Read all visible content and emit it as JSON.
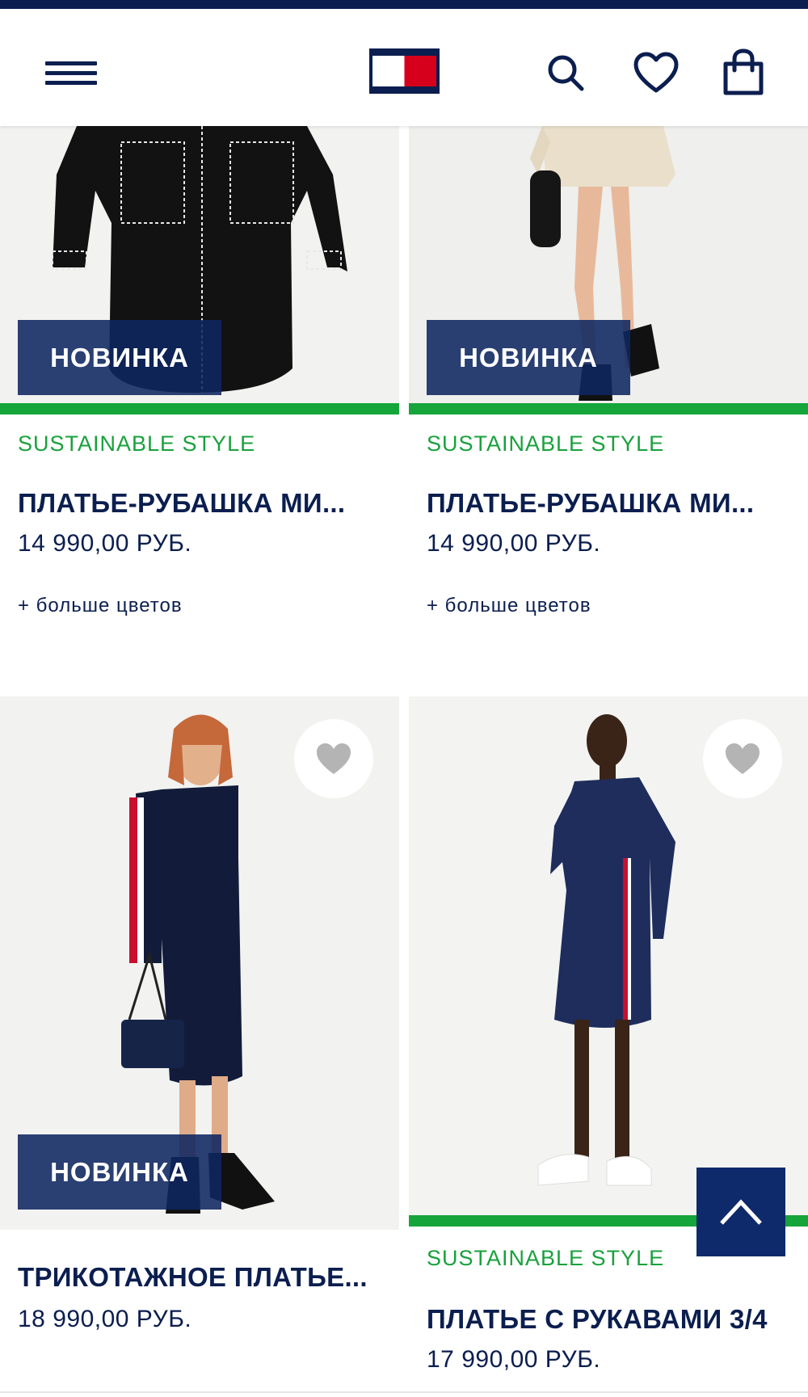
{
  "header": {
    "menu_icon": "hamburger-menu-icon",
    "logo": "tommy-hilfiger-flag-logo",
    "search_icon": "search-icon",
    "wishlist_icon": "heart-icon",
    "cart_icon": "shopping-bag-icon",
    "brand_colors": {
      "navy": "#0b1e4f",
      "red": "#d6001c",
      "white": "#ffffff"
    }
  },
  "products": [
    {
      "badge": "НОВИНКА",
      "label": "SUSTAINABLE STYLE",
      "title": "ПЛАТЬЕ-РУБАШКА МИ...",
      "price": "14 990,00 РУБ.",
      "more_colors": "+ больше цветов"
    },
    {
      "badge": "НОВИНКА",
      "label": "SUSTAINABLE STYLE",
      "title": "ПЛАТЬЕ-РУБАШКА МИ...",
      "price": "14 990,00 РУБ.",
      "more_colors": "+ больше цветов"
    },
    {
      "badge": "НОВИНКА",
      "title": "ТРИКОТАЖНОЕ ПЛАТЬЕ...",
      "price": "18 990,00 РУБ."
    },
    {
      "label": "SUSTAINABLE STYLE",
      "title": "ПЛАТЬЕ С РУКАВАМИ 3/4",
      "price": "17 990,00 РУБ."
    }
  ],
  "accent_colors": {
    "sustainable_green": "#16a53a",
    "badge_navy": "#0e2560"
  },
  "back_to_top_icon": "chevron-up-icon"
}
